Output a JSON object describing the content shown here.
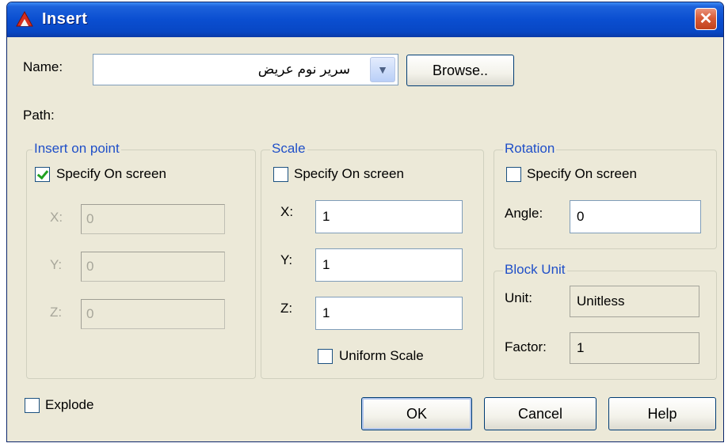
{
  "window": {
    "title": "Insert",
    "close_glyph": "✕"
  },
  "name": {
    "label": "Name:",
    "value": "سرير نوم عريض",
    "browse_label": "Browse.."
  },
  "path": {
    "label": "Path:"
  },
  "insertion_point": {
    "title": "Insert on point",
    "specify_label": "Specify On screen",
    "specify_checked": true,
    "x_label": "X:",
    "x_value": "0",
    "y_label": "Y:",
    "y_value": "0",
    "z_label": "Z:",
    "z_value": "0"
  },
  "scale": {
    "title": "Scale",
    "specify_label": "Specify On screen",
    "specify_checked": false,
    "x_label": "X:",
    "x_value": "1",
    "y_label": "Y:",
    "y_value": "1",
    "z_label": "Z:",
    "z_value": "1",
    "uniform_label": "Uniform Scale",
    "uniform_checked": false
  },
  "rotation": {
    "title": "Rotation",
    "specify_label": "Specify On screen",
    "specify_checked": false,
    "angle_label": "Angle:",
    "angle_value": "0"
  },
  "block_unit": {
    "title": "Block Unit",
    "unit_label": "Unit:",
    "unit_value": "Unitless",
    "factor_label": "Factor:",
    "factor_value": "1"
  },
  "explode": {
    "label": "Explode",
    "checked": false
  },
  "buttons": {
    "ok": "OK",
    "cancel": "Cancel",
    "help": "Help"
  },
  "colors": {
    "titlebar": "#0a4ed0",
    "dialog_bg": "#ece9d8",
    "group_title": "#1f4fc8",
    "close_button": "#d85c38",
    "checkmark": "#21a121"
  }
}
